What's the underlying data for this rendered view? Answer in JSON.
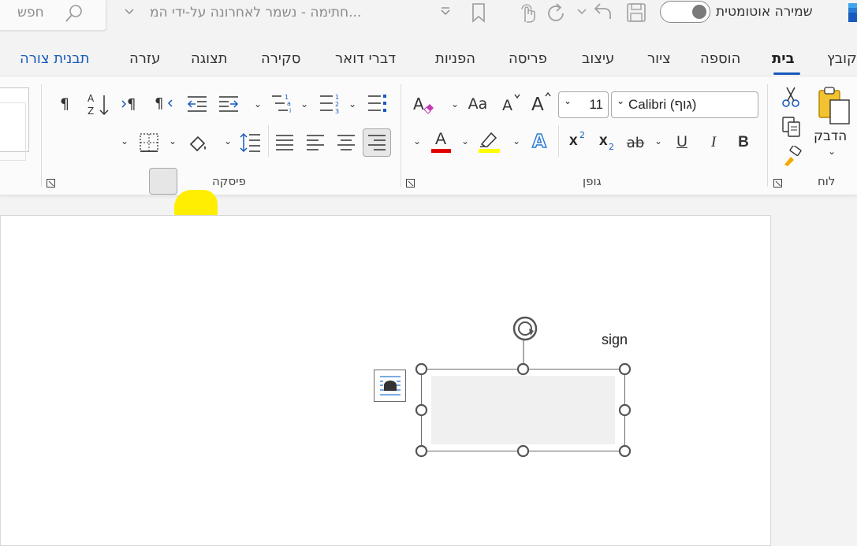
{
  "titlebar": {
    "search_placeholder": "חפש",
    "document_title": "חתימה  -  נשמר לאחרונה על-ידי המ...",
    "autosave_label": "שמירה אוטומטית",
    "word_icon": "word-app-icon"
  },
  "tabs": [
    {
      "label": "קובץ"
    },
    {
      "label": "בית",
      "active": true
    },
    {
      "label": "הוספה"
    },
    {
      "label": "ציור"
    },
    {
      "label": "עיצוב"
    },
    {
      "label": "פריסה"
    },
    {
      "label": "הפניות"
    },
    {
      "label": "דברי דואר"
    },
    {
      "label": "סקירה"
    },
    {
      "label": "תצוגה"
    },
    {
      "label": "עזרה"
    },
    {
      "label": "תבנית צורה",
      "accent": true
    }
  ],
  "ribbon": {
    "clipboard": {
      "paste_label": "הדבק",
      "group_label": "לוח"
    },
    "font": {
      "font_name": "Calibri (גוף)",
      "font_size": "11",
      "group_label": "גופן",
      "bold": "B",
      "italic": "I",
      "underline": "U",
      "strike": "ab",
      "subscript_base": "x",
      "subscript_mark": "2",
      "superscript_base": "x",
      "superscript_mark": "2",
      "case": "Aa",
      "grow": "A",
      "shrink": "A",
      "text_effects": "A",
      "font_color_letter": "A",
      "font_color": "#e00000",
      "highlight_color": "#ffff00"
    },
    "paragraph": {
      "group_label": "פיסקה",
      "pilcrow": "¶"
    }
  },
  "document": {
    "sign_text": "sign"
  },
  "colors": {
    "accent": "#185abd",
    "annotation_highlight": "#ffee00"
  }
}
